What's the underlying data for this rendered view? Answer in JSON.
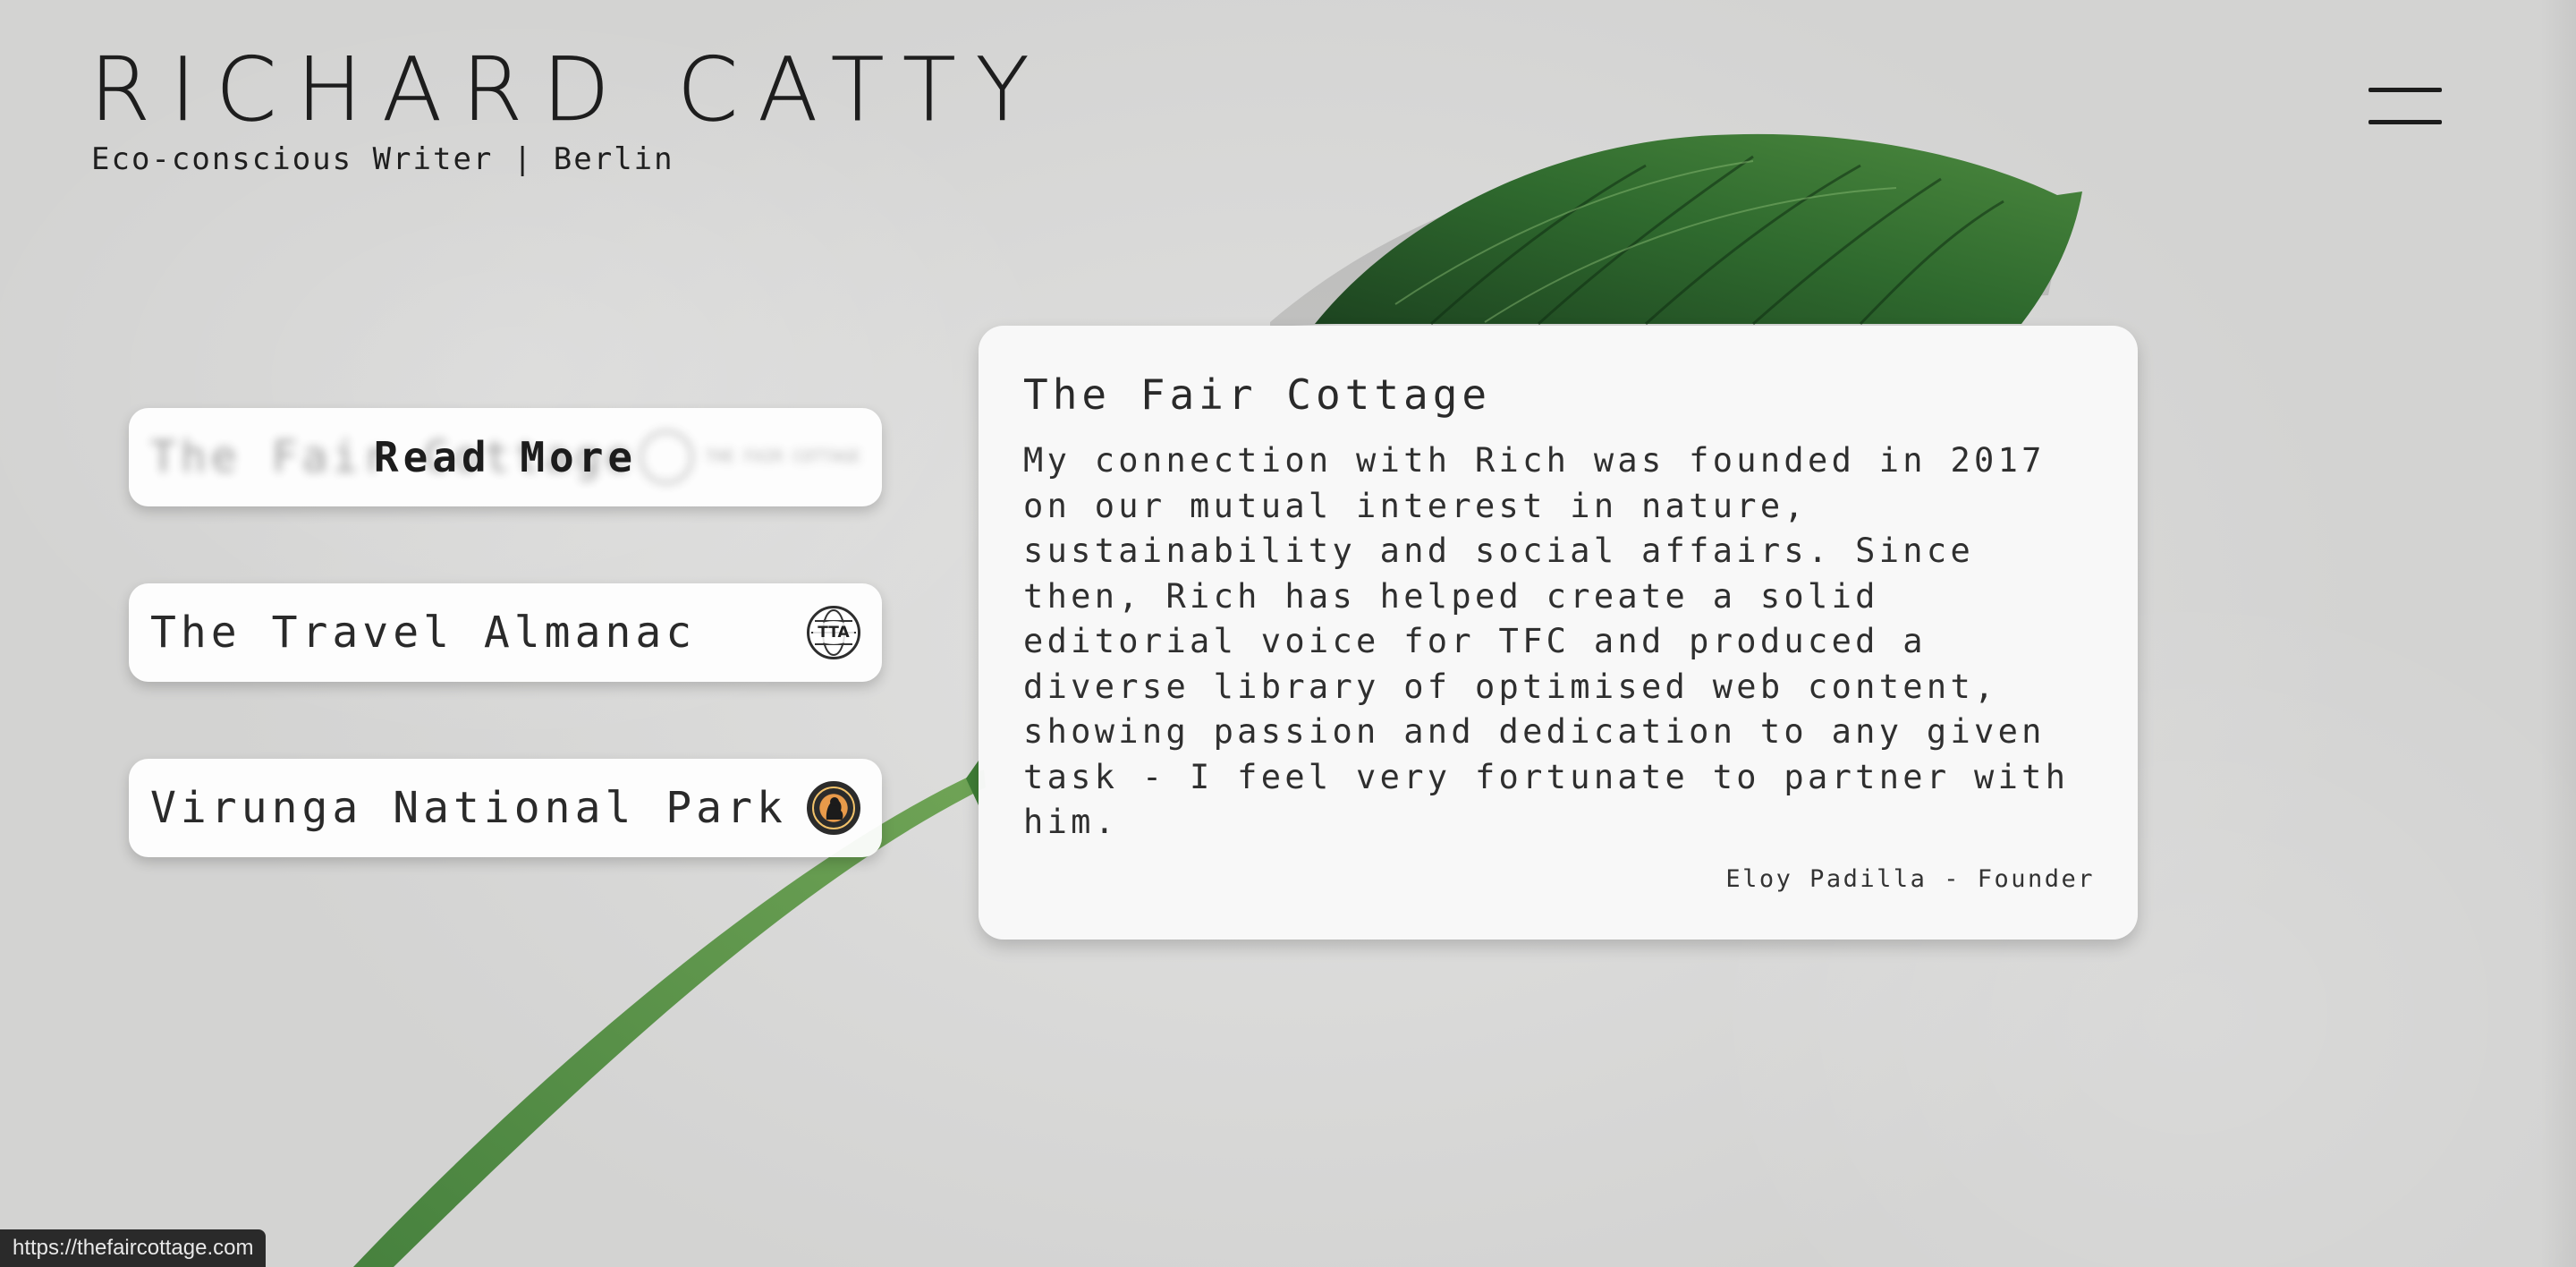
{
  "header": {
    "logo": "RICHARD CATTY",
    "tagline": "Eco-conscious Writer | Berlin"
  },
  "menu": {
    "icon": "hamburger-menu-icon"
  },
  "clients": [
    {
      "name": "The Fair Cottage",
      "hover_label": "Read More",
      "badge_icon": "the-fair-cottage-logo-icon",
      "badge_caption": "THE FAIR COTTAGE"
    },
    {
      "name": "The Travel Almanac",
      "badge_icon": "globe-tta-logo-icon",
      "badge_text": "TTA"
    },
    {
      "name": "Virunga National Park",
      "badge_icon": "virunga-gorilla-logo-icon"
    }
  ],
  "testimonial": {
    "title": "The Fair Cottage",
    "body": "My connection with Rich was founded in 2017 on our mutual interest in nature, sustainability and social affairs. Since then, Rich has helped create a solid editorial voice for TFC and produced a diverse library of optimised web content, showing passion and dedication to any given task - I feel very fortunate to partner with him.",
    "signature": "Eloy Padilla - Founder"
  },
  "status_bar": {
    "url": "https://thefaircottage.com"
  },
  "colors": {
    "background": "#dcdcdb",
    "card": "#f9f9f9",
    "text": "#262626",
    "leaf_dark": "#1f4a22",
    "leaf_mid": "#3e7a3a"
  }
}
